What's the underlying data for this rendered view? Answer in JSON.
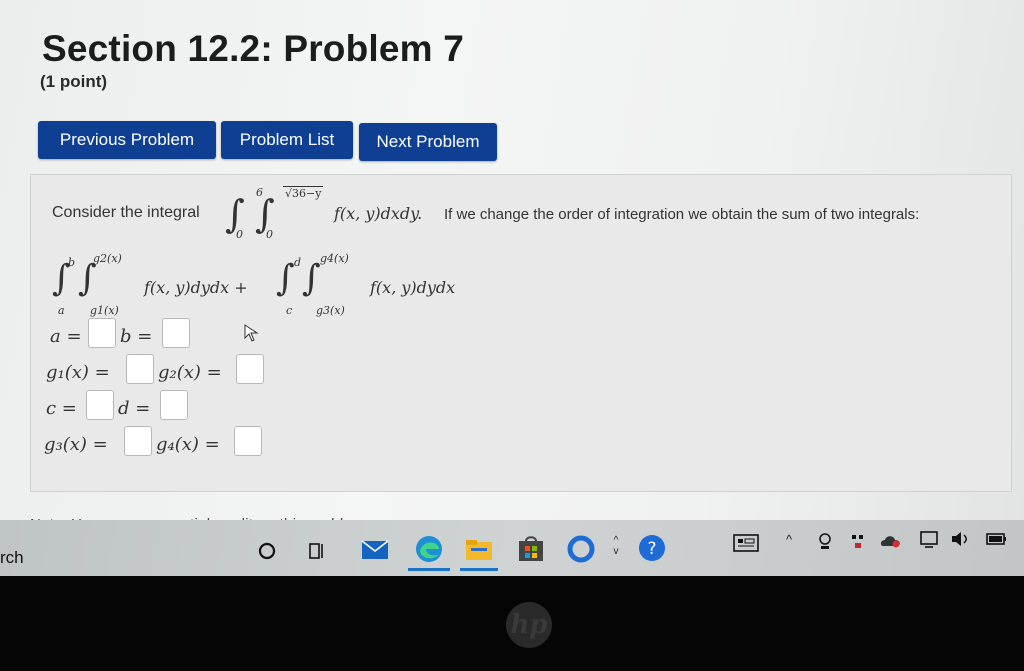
{
  "header": {
    "title": "Section 12.2: Problem 7",
    "points": "(1 point)"
  },
  "nav": {
    "previous": "Previous Problem",
    "list": "Problem List",
    "next": "Next Problem"
  },
  "problem": {
    "prompt_start": "Consider the integral",
    "prompt_end": "If we change the order of integration we obtain the sum of two integrals:",
    "integrand": "f(x, y)dxdy.",
    "outer_lower": "0",
    "outer_upper": "6",
    "inner_lower": "0",
    "inner_upper": "√36−y",
    "sum": {
      "first_lower": "a",
      "first_upper": "b",
      "first_inner_lower": "g1(x)",
      "first_inner_upper": "g2(x)",
      "first_integrand": "f(x, y)dydx +",
      "second_lower": "c",
      "second_upper": "d",
      "second_inner_lower": "g3(x)",
      "second_inner_upper": "g4(x)",
      "second_integrand": "f(x, y)dydx"
    },
    "fields": {
      "a": "a =",
      "b": "b =",
      "g1": "g₁(x) =",
      "g2": "g₂(x) =",
      "c": "c =",
      "d": "d =",
      "g3": "g₃(x) =",
      "g4": "g₄(x) ="
    }
  },
  "note": "Note: You can earn partial credit on this problem.",
  "taskbar": {
    "search": "rch",
    "icons": [
      "cortana-icon",
      "task-view-icon",
      "mail-icon",
      "edge-icon",
      "file-explorer-icon",
      "store-icon",
      "circle-app-icon",
      "help-icon"
    ],
    "tray_icons": [
      "keyboard-icon",
      "chevron-up-icon",
      "camera-icon",
      "network-icon",
      "onedrive-icon",
      "display-icon",
      "volume-icon",
      "battery-icon"
    ]
  },
  "bezel": {
    "logo": "hp"
  }
}
